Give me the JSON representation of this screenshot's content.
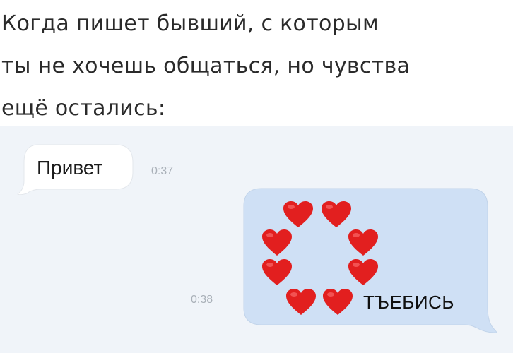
{
  "caption": {
    "lines": [
      "Когда пишет бывший, с которым",
      "ты не хочешь общаться, но чувства",
      "ещё остались:"
    ]
  },
  "chat": {
    "incoming": {
      "text": "Привет",
      "time": "0:37"
    },
    "outgoing": {
      "hearts": [
        "red-heart-emoji",
        "red-heart-emoji",
        "red-heart-emoji",
        "red-heart-emoji",
        "red-heart-emoji",
        "red-heart-emoji",
        "red-heart-emoji",
        "red-heart-emoji"
      ],
      "text": "ТЪЕБИСЬ",
      "time": "0:38"
    }
  },
  "colors": {
    "chat_background": "#f0f4f9",
    "incoming_bubble": "#ffffff",
    "outgoing_bubble": "#cfe0f5",
    "heart": "#e21f1f"
  }
}
